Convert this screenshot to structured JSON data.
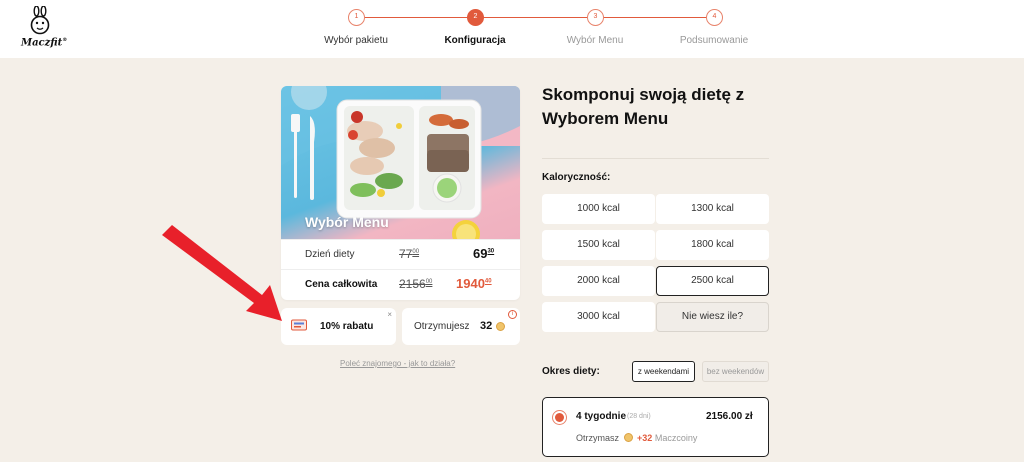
{
  "brand": {
    "name": "Maczfit",
    "reg": "®"
  },
  "steps": [
    {
      "num": "1",
      "label": "Wybór pakietu",
      "state": "done"
    },
    {
      "num": "2",
      "label": "Konfiguracja",
      "state": "active"
    },
    {
      "num": "3",
      "label": "Wybór Menu",
      "state": "todo"
    },
    {
      "num": "4",
      "label": "Podsumowanie",
      "state": "todo"
    }
  ],
  "product": {
    "title": "Wybór Menu",
    "day_price": {
      "label": "Dzień diety",
      "old": "77",
      "old_cents": "00",
      "new": "69",
      "new_cents": "30"
    },
    "total_price": {
      "label": "Cena całkowita",
      "old": "2156",
      "old_cents": "00",
      "new": "1940",
      "new_cents": "40"
    }
  },
  "discount": {
    "label": "10% rabatu",
    "close": "×"
  },
  "coins": {
    "label": "Otrzymujesz",
    "value": "32",
    "info": "i"
  },
  "referral_link": "Poleć znajomego - jak to działa?",
  "config": {
    "title": "Skomponuj swoją dietę z Wyborem Menu",
    "calories_label": "Kaloryczność:",
    "calories": [
      "1000 kcal",
      "1300 kcal",
      "1500 kcal",
      "1800 kcal",
      "2000 kcal",
      "2500 kcal",
      "3000 kcal",
      "Nie wiesz ile?"
    ],
    "selected_calorie": "2500 kcal",
    "period_label": "Okres diety:",
    "weekend_on": "z weekendami",
    "weekend_off": "bez weekendów",
    "plan": {
      "name": "4 tygodnie",
      "days": "(28 dni)",
      "price": "2156.00 zł",
      "receive": "Otrzymasz",
      "plus": "+32",
      "unit": "Maczcoiny"
    }
  },
  "colors": {
    "accent": "#e15a3c",
    "background": "#f4efe8",
    "arrow": "#e8202a"
  }
}
